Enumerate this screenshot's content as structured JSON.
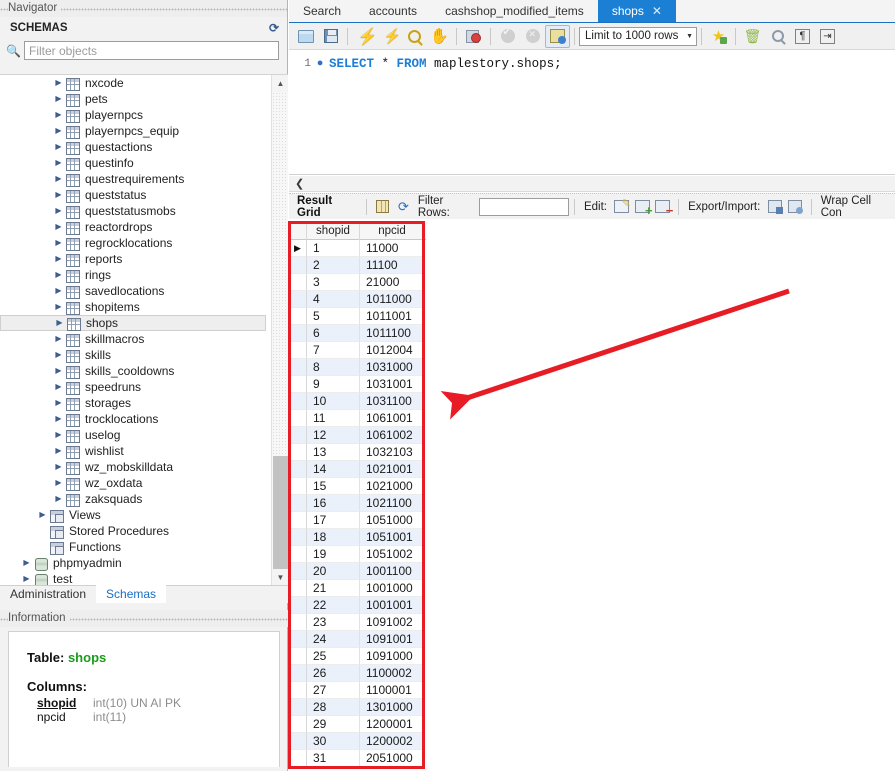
{
  "navigator": {
    "caption": "Navigator",
    "schemas_title": "SCHEMAS",
    "refresh_icon": "refresh-icon",
    "filter_placeholder": "Filter objects",
    "search_icon": "search-icon",
    "tree": [
      {
        "label": "nxcode",
        "type": "table",
        "indent": 3,
        "expandable": true
      },
      {
        "label": "pets",
        "type": "table",
        "indent": 3,
        "expandable": true
      },
      {
        "label": "playernpcs",
        "type": "table",
        "indent": 3,
        "expandable": true
      },
      {
        "label": "playernpcs_equip",
        "type": "table",
        "indent": 3,
        "expandable": true
      },
      {
        "label": "questactions",
        "type": "table",
        "indent": 3,
        "expandable": true
      },
      {
        "label": "questinfo",
        "type": "table",
        "indent": 3,
        "expandable": true
      },
      {
        "label": "questrequirements",
        "type": "table",
        "indent": 3,
        "expandable": true
      },
      {
        "label": "queststatus",
        "type": "table",
        "indent": 3,
        "expandable": true
      },
      {
        "label": "queststatusmobs",
        "type": "table",
        "indent": 3,
        "expandable": true
      },
      {
        "label": "reactordrops",
        "type": "table",
        "indent": 3,
        "expandable": true
      },
      {
        "label": "regrocklocations",
        "type": "table",
        "indent": 3,
        "expandable": true
      },
      {
        "label": "reports",
        "type": "table",
        "indent": 3,
        "expandable": true
      },
      {
        "label": "rings",
        "type": "table",
        "indent": 3,
        "expandable": true
      },
      {
        "label": "savedlocations",
        "type": "table",
        "indent": 3,
        "expandable": true
      },
      {
        "label": "shopitems",
        "type": "table",
        "indent": 3,
        "expandable": true
      },
      {
        "label": "shops",
        "type": "table",
        "indent": 3,
        "expandable": true,
        "selected": true
      },
      {
        "label": "skillmacros",
        "type": "table",
        "indent": 3,
        "expandable": true
      },
      {
        "label": "skills",
        "type": "table",
        "indent": 3,
        "expandable": true
      },
      {
        "label": "skills_cooldowns",
        "type": "table",
        "indent": 3,
        "expandable": true
      },
      {
        "label": "speedruns",
        "type": "table",
        "indent": 3,
        "expandable": true
      },
      {
        "label": "storages",
        "type": "table",
        "indent": 3,
        "expandable": true
      },
      {
        "label": "trocklocations",
        "type": "table",
        "indent": 3,
        "expandable": true
      },
      {
        "label": "uselog",
        "type": "table",
        "indent": 3,
        "expandable": true
      },
      {
        "label": "wishlist",
        "type": "table",
        "indent": 3,
        "expandable": true
      },
      {
        "label": "wz_mobskilldata",
        "type": "table",
        "indent": 3,
        "expandable": true
      },
      {
        "label": "wz_oxdata",
        "type": "table",
        "indent": 3,
        "expandable": true
      },
      {
        "label": "zaksquads",
        "type": "table",
        "indent": 3,
        "expandable": true
      },
      {
        "label": "Views",
        "type": "view",
        "indent": 2,
        "expandable": true
      },
      {
        "label": "Stored Procedures",
        "type": "view",
        "indent": 2,
        "expandable": false
      },
      {
        "label": "Functions",
        "type": "view",
        "indent": 2,
        "expandable": false
      },
      {
        "label": "phpmyadmin",
        "type": "db",
        "indent": 1,
        "expandable": true
      },
      {
        "label": "test",
        "type": "db",
        "indent": 1,
        "expandable": true
      }
    ],
    "scroll_up_icon": "chevron-up-icon",
    "scroll_down_icon": "chevron-down-icon",
    "tabs": [
      {
        "label": "Administration",
        "active": false
      },
      {
        "label": "Schemas",
        "active": true
      }
    ]
  },
  "information": {
    "caption": "Information",
    "table_label": "Table:",
    "table_name": "shops",
    "columns_label": "Columns:",
    "columns": [
      {
        "name": "shopid",
        "type": "int(10) UN AI PK",
        "pk": true
      },
      {
        "name": "npcid",
        "type": "int(11)",
        "pk": false
      }
    ]
  },
  "editor_tabs": [
    {
      "label": "Search",
      "active": false,
      "closable": false
    },
    {
      "label": "accounts",
      "active": false,
      "closable": false
    },
    {
      "label": "cashshop_modified_items",
      "active": false,
      "closable": false
    },
    {
      "label": "shops",
      "active": true,
      "closable": true,
      "close_icon": "close-icon"
    }
  ],
  "toolbar": {
    "items": [
      {
        "name": "open-sql-script-icon",
        "icon": "folder-icon"
      },
      {
        "name": "save-script-icon",
        "icon": "save-icon"
      },
      {
        "name": "execute-statement-icon",
        "icon": "lightning-bolt-icon"
      },
      {
        "name": "execute-current-statement-icon",
        "icon": "lightning-bolt-cursor-icon"
      },
      {
        "name": "explain-statement-icon",
        "icon": "magnifier-bolt-icon"
      },
      {
        "name": "stop-statement-icon",
        "icon": "stop-hand-icon"
      },
      {
        "name": "toggle-stop-on-error-icon",
        "icon": "stop-on-error-icon"
      },
      {
        "name": "commit-icon",
        "icon": "commit-check-icon"
      },
      {
        "name": "rollback-icon",
        "icon": "rollback-x-icon"
      },
      {
        "name": "toggle-autocommit-icon",
        "icon": "autocommit-icon"
      }
    ],
    "limit_label": "Limit to 1000 rows",
    "limit_caret": "chevron-down-icon",
    "right_items": [
      {
        "name": "beautify-query-icon",
        "icon": "star-plus-icon"
      },
      {
        "name": "clear-context-icon",
        "icon": "broom-icon"
      },
      {
        "name": "find-icon",
        "icon": "magnifier-icon"
      },
      {
        "name": "toggle-invisible-chars-icon",
        "icon": "pilcrow-icon"
      },
      {
        "name": "toggle-word-wrap-icon",
        "icon": "wrap-arrow-icon"
      }
    ]
  },
  "sql_editor": {
    "line_number": "1",
    "bookmark_icon": "dot-icon",
    "query_keyword_select": "SELECT",
    "query_star": " * ",
    "query_keyword_from": "FROM",
    "query_target": " maplestory.shops;"
  },
  "splitter": {
    "collapse_icon": "chevron-left-icon"
  },
  "result_toolbar": {
    "result_grid_label": "Result Grid",
    "grid_toggle_icon": "grid-view-icon",
    "refresh_icon": "refresh-icon",
    "filter_rows_label": "Filter Rows:",
    "filter_rows_value": "",
    "edit_label": "Edit:",
    "edit_icons": [
      "edit-cell-icon",
      "insert-row-icon",
      "delete-row-icon"
    ],
    "export_import_label": "Export/Import:",
    "export_icon": "export-recordset-icon",
    "import_icon": "import-recordset-icon",
    "wrap_label": "Wrap Cell Con"
  },
  "result_grid": {
    "columns": [
      "shopid",
      "npcid"
    ],
    "current_row_marker": "play-triangle-icon",
    "rows": [
      {
        "shopid": "1",
        "npcid": "11000"
      },
      {
        "shopid": "2",
        "npcid": "11100"
      },
      {
        "shopid": "3",
        "npcid": "21000"
      },
      {
        "shopid": "4",
        "npcid": "1011000"
      },
      {
        "shopid": "5",
        "npcid": "1011001"
      },
      {
        "shopid": "6",
        "npcid": "1011100"
      },
      {
        "shopid": "7",
        "npcid": "1012004"
      },
      {
        "shopid": "8",
        "npcid": "1031000"
      },
      {
        "shopid": "9",
        "npcid": "1031001"
      },
      {
        "shopid": "10",
        "npcid": "1031100"
      },
      {
        "shopid": "11",
        "npcid": "1061001"
      },
      {
        "shopid": "12",
        "npcid": "1061002"
      },
      {
        "shopid": "13",
        "npcid": "1032103"
      },
      {
        "shopid": "14",
        "npcid": "1021001"
      },
      {
        "shopid": "15",
        "npcid": "1021000"
      },
      {
        "shopid": "16",
        "npcid": "1021100"
      },
      {
        "shopid": "17",
        "npcid": "1051000"
      },
      {
        "shopid": "18",
        "npcid": "1051001"
      },
      {
        "shopid": "19",
        "npcid": "1051002"
      },
      {
        "shopid": "20",
        "npcid": "1001100"
      },
      {
        "shopid": "21",
        "npcid": "1001000"
      },
      {
        "shopid": "22",
        "npcid": "1001001"
      },
      {
        "shopid": "23",
        "npcid": "1091002"
      },
      {
        "shopid": "24",
        "npcid": "1091001"
      },
      {
        "shopid": "25",
        "npcid": "1091000"
      },
      {
        "shopid": "26",
        "npcid": "1100002"
      },
      {
        "shopid": "27",
        "npcid": "1100001"
      },
      {
        "shopid": "28",
        "npcid": "1301000"
      },
      {
        "shopid": "29",
        "npcid": "1200001"
      },
      {
        "shopid": "30",
        "npcid": "1200002"
      },
      {
        "shopid": "31",
        "npcid": "2051000"
      }
    ]
  },
  "annotations": {
    "highlight_color": "#e81c24",
    "arrow_color": "#e81c24"
  }
}
